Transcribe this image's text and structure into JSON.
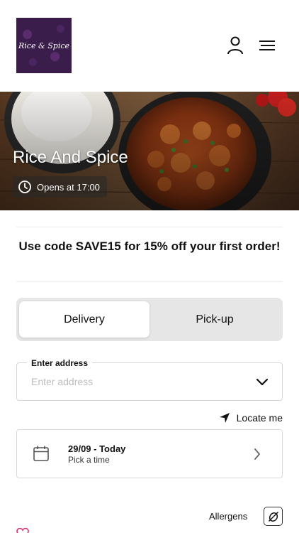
{
  "header": {
    "logo_text": "Rice & Spice",
    "account_icon": "person-icon",
    "menu_icon": "hamburger-menu-icon"
  },
  "hero": {
    "restaurant_name": "Rice And Spice",
    "opening_text": "Opens at 17:00",
    "clock_icon": "clock-icon"
  },
  "promo": {
    "text": "Use code SAVE15 for 15% off your first order!"
  },
  "order_type": {
    "options": [
      "Delivery",
      "Pick-up"
    ],
    "selected": "Delivery"
  },
  "address": {
    "label": "Enter address",
    "placeholder": "Enter address",
    "value": ""
  },
  "locate": {
    "label": "Locate me",
    "icon": "location-arrow-icon"
  },
  "schedule": {
    "date_label": "29/09 - Today",
    "time_label": "Pick a time",
    "icon": "calendar-icon"
  },
  "allergens": {
    "label": "Allergens",
    "icon": "allergen-icon"
  },
  "colors": {
    "toggle_bg": "#e6e6e6",
    "logo_bg": "#3a1d4a",
    "accent_pink": "#e8336b"
  }
}
